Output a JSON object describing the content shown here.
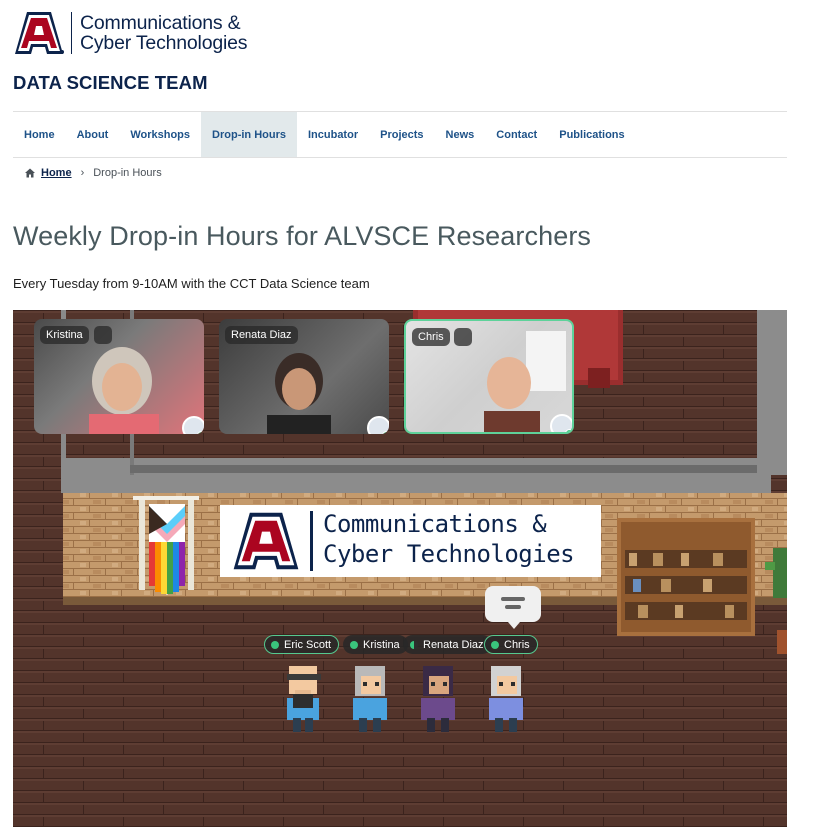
{
  "header": {
    "logo_line1": "Communications &",
    "logo_line2": "Cyber Technologies",
    "site_title": "DATA SCIENCE TEAM"
  },
  "nav": {
    "items": [
      "Home",
      "About",
      "Workshops",
      "Drop-in Hours",
      "Incubator",
      "Projects",
      "News",
      "Contact",
      "Publications"
    ],
    "active": "Drop-in Hours"
  },
  "breadcrumb": {
    "home": "Home",
    "separator": "›",
    "current": "Drop-in Hours"
  },
  "main": {
    "headline": "Weekly Drop-in Hours for ALVSCE Researchers",
    "subhead": "Every Tuesday from 9-10AM with the CCT Data Science team"
  },
  "scene": {
    "video_tiles": [
      {
        "name": "Kristina"
      },
      {
        "name": "Renata Diaz"
      },
      {
        "name": "Chris"
      }
    ],
    "sign_line1": "Communications &",
    "sign_line2": "Cyber Technologies",
    "name_tags": [
      "Eric Scott",
      "Kristina",
      "Renata Diaz",
      "Chris"
    ]
  },
  "colors": {
    "brand_navy": "#0c234b",
    "brand_red": "#ab0520",
    "nav_link": "#1e5288",
    "active_nav_bg": "#e2e9eb",
    "online_green": "#3ac47d"
  }
}
